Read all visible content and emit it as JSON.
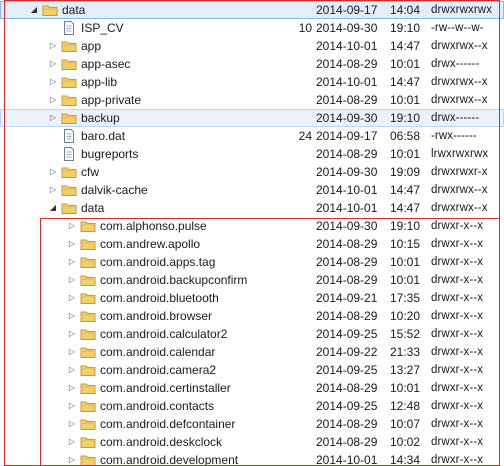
{
  "tree": {
    "rows": [
      {
        "name": "data",
        "type": "folder",
        "indent": 0,
        "twisty": "open",
        "size": "",
        "date": "2014-09-17",
        "time": "14:04",
        "perm": "drwxrwxrwx",
        "state": "selected"
      },
      {
        "name": "ISP_CV",
        "type": "file",
        "indent": 1,
        "twisty": "none",
        "size": "10",
        "date": "2014-09-30",
        "time": "19:10",
        "perm": "-rw--w--w-",
        "state": ""
      },
      {
        "name": "app",
        "type": "folder",
        "indent": 1,
        "twisty": "closed",
        "size": "",
        "date": "2014-10-01",
        "time": "14:47",
        "perm": "drwxrwx--x",
        "state": ""
      },
      {
        "name": "app-asec",
        "type": "folder",
        "indent": 1,
        "twisty": "closed",
        "size": "",
        "date": "2014-08-29",
        "time": "10:01",
        "perm": "drwx------",
        "state": ""
      },
      {
        "name": "app-lib",
        "type": "folder",
        "indent": 1,
        "twisty": "closed",
        "size": "",
        "date": "2014-10-01",
        "time": "14:47",
        "perm": "drwxrwx--x",
        "state": ""
      },
      {
        "name": "app-private",
        "type": "folder",
        "indent": 1,
        "twisty": "closed",
        "size": "",
        "date": "2014-08-29",
        "time": "10:01",
        "perm": "drwxrwx--x",
        "state": ""
      },
      {
        "name": "backup",
        "type": "folder",
        "indent": 1,
        "twisty": "closed",
        "size": "",
        "date": "2014-09-30",
        "time": "19:10",
        "perm": "drwx------",
        "state": "hover"
      },
      {
        "name": "baro.dat",
        "type": "file",
        "indent": 1,
        "twisty": "none",
        "size": "24",
        "date": "2014-09-17",
        "time": "06:58",
        "perm": "-rwx------",
        "state": ""
      },
      {
        "name": "bugreports",
        "type": "file",
        "indent": 1,
        "twisty": "none",
        "size": "",
        "date": "2014-08-29",
        "time": "10:01",
        "perm": "lrwxrwxrwx",
        "state": ""
      },
      {
        "name": "cfw",
        "type": "folder",
        "indent": 1,
        "twisty": "closed",
        "size": "",
        "date": "2014-09-30",
        "time": "19:09",
        "perm": "drwxrwxr-x",
        "state": ""
      },
      {
        "name": "dalvik-cache",
        "type": "folder",
        "indent": 1,
        "twisty": "closed",
        "size": "",
        "date": "2014-10-01",
        "time": "14:47",
        "perm": "drwxrwx--x",
        "state": ""
      },
      {
        "name": "data",
        "type": "folder",
        "indent": 1,
        "twisty": "open",
        "size": "",
        "date": "2014-10-01",
        "time": "14:47",
        "perm": "drwxrwx--x",
        "state": ""
      },
      {
        "name": "com.alphonso.pulse",
        "type": "folder",
        "indent": 2,
        "twisty": "closed",
        "size": "",
        "date": "2014-09-30",
        "time": "19:10",
        "perm": "drwxr-x--x",
        "state": ""
      },
      {
        "name": "com.andrew.apollo",
        "type": "folder",
        "indent": 2,
        "twisty": "closed",
        "size": "",
        "date": "2014-08-29",
        "time": "10:15",
        "perm": "drwxr-x--x",
        "state": ""
      },
      {
        "name": "com.android.apps.tag",
        "type": "folder",
        "indent": 2,
        "twisty": "closed",
        "size": "",
        "date": "2014-08-29",
        "time": "10:01",
        "perm": "drwxr-x--x",
        "state": ""
      },
      {
        "name": "com.android.backupconfirm",
        "type": "folder",
        "indent": 2,
        "twisty": "closed",
        "size": "",
        "date": "2014-08-29",
        "time": "10:01",
        "perm": "drwxr-x--x",
        "state": ""
      },
      {
        "name": "com.android.bluetooth",
        "type": "folder",
        "indent": 2,
        "twisty": "closed",
        "size": "",
        "date": "2014-09-21",
        "time": "17:35",
        "perm": "drwxr-x--x",
        "state": ""
      },
      {
        "name": "com.android.browser",
        "type": "folder",
        "indent": 2,
        "twisty": "closed",
        "size": "",
        "date": "2014-08-29",
        "time": "10:20",
        "perm": "drwxr-x--x",
        "state": ""
      },
      {
        "name": "com.android.calculator2",
        "type": "folder",
        "indent": 2,
        "twisty": "closed",
        "size": "",
        "date": "2014-09-25",
        "time": "15:52",
        "perm": "drwxr-x--x",
        "state": ""
      },
      {
        "name": "com.android.calendar",
        "type": "folder",
        "indent": 2,
        "twisty": "closed",
        "size": "",
        "date": "2014-09-22",
        "time": "21:33",
        "perm": "drwxr-x--x",
        "state": ""
      },
      {
        "name": "com.android.camera2",
        "type": "folder",
        "indent": 2,
        "twisty": "closed",
        "size": "",
        "date": "2014-09-25",
        "time": "13:27",
        "perm": "drwxr-x--x",
        "state": ""
      },
      {
        "name": "com.android.certinstaller",
        "type": "folder",
        "indent": 2,
        "twisty": "closed",
        "size": "",
        "date": "2014-08-29",
        "time": "10:01",
        "perm": "drwxr-x--x",
        "state": ""
      },
      {
        "name": "com.android.contacts",
        "type": "folder",
        "indent": 2,
        "twisty": "closed",
        "size": "",
        "date": "2014-09-25",
        "time": "12:48",
        "perm": "drwxr-x--x",
        "state": ""
      },
      {
        "name": "com.android.defcontainer",
        "type": "folder",
        "indent": 2,
        "twisty": "closed",
        "size": "",
        "date": "2014-08-29",
        "time": "10:07",
        "perm": "drwxr-x--x",
        "state": ""
      },
      {
        "name": "com.android.deskclock",
        "type": "folder",
        "indent": 2,
        "twisty": "closed",
        "size": "",
        "date": "2014-08-29",
        "time": "10:02",
        "perm": "drwxr-x--x",
        "state": ""
      },
      {
        "name": "com.android.development",
        "type": "folder",
        "indent": 2,
        "twisty": "closed",
        "size": "",
        "date": "2014-10-01",
        "time": "14:34",
        "perm": "drwxr-x--x",
        "state": ""
      }
    ]
  },
  "colors": {
    "folder_fill": "#f3cf6a",
    "folder_stroke": "#c99a2e",
    "file_stroke": "#6b7f99",
    "highlight_box": "#d62b2b",
    "selected_bg": "#e3eefb"
  },
  "icons": {
    "folder": "folder-icon",
    "file": "file-icon",
    "expanded": "triangle-down-icon",
    "collapsed": "triangle-right-icon"
  }
}
